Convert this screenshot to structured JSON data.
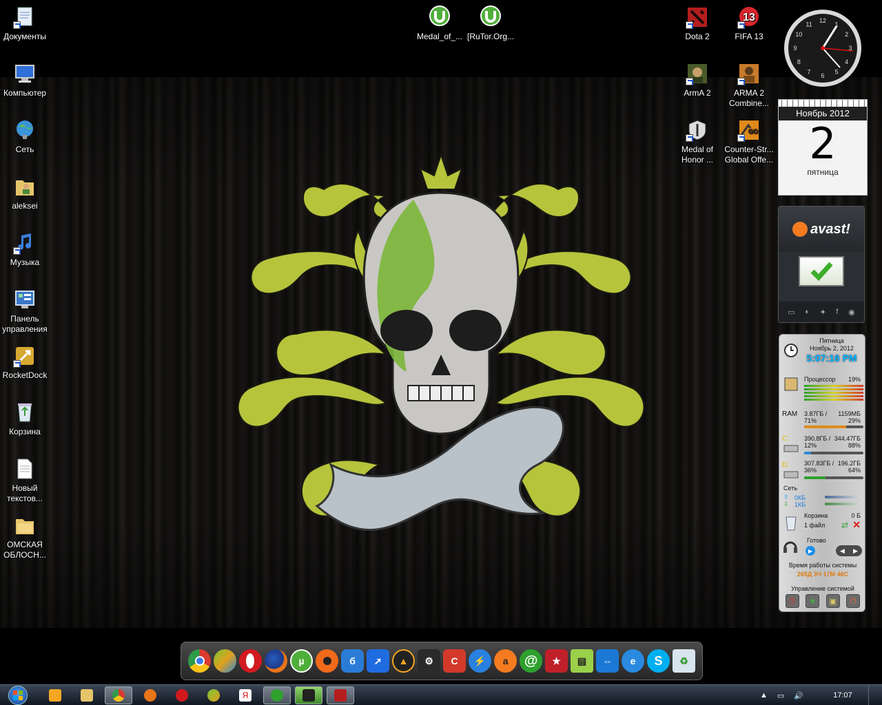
{
  "desktop_icons": {
    "documents": "Документы",
    "computer": "Компьютер",
    "network": "Сеть",
    "user": "aleksei",
    "music": "Музыка",
    "control_panel": "Панель управления",
    "rocketdock": "RocketDock",
    "recycle_bin": "Корзина",
    "new_text": "Новый текстов...",
    "folder": "ОМСКАЯ ОБЛОСН...",
    "torrent1": "Medal_of_...",
    "torrent2": "[RuTor.Org...",
    "dota2": "Dota 2",
    "fifa13": "FIFA 13",
    "fifa_badge": "13",
    "arma2": "ArmA 2",
    "arma2co": "ARMA 2 Combine...",
    "moh": "Medal of Honor ...",
    "csgo": "Counter-Str... Global Offe...",
    "csgo_badge": "GO"
  },
  "calendar": {
    "month": "Ноябрь 2012",
    "day": "2",
    "weekday": "пятница"
  },
  "avast": {
    "logo": "avast!"
  },
  "clock": {
    "numbers": [
      "12",
      "1",
      "2",
      "3",
      "4",
      "5",
      "6",
      "7",
      "8",
      "9",
      "10",
      "11"
    ]
  },
  "system_gadget": {
    "weekday": "Пятница",
    "date": "Ноябрь 2, 2012",
    "time": "5:07:16 PM",
    "cpu_label": "Процессор",
    "cpu_pct": "19%",
    "ram_label": "RAM",
    "ram_used": "3.87ГБ / 71%",
    "ram_free": "1159МБ 29%",
    "c_label": "C:",
    "c_used": "390.8ГБ / 12%",
    "c_free": "344.47ГБ 88%",
    "d_label": "D:",
    "d_used": "307.83ГБ / 36%",
    "d_free": "196.2ГБ 64%",
    "net_label": "Сеть",
    "net_up": "0КБ",
    "net_down": "1КБ",
    "bin_label": "Корзина",
    "bin_size": "0 Б",
    "bin_files": "1 файл",
    "media_status": "Готово",
    "uptime_label": "Время работы системы",
    "uptime": "265Д 3Ч 17М 46С",
    "control_label": "Управление системой"
  },
  "taskbar": {
    "time": "17:07"
  },
  "dock_items": [
    "chrome-icon",
    "mediaget-icon",
    "opera-icon",
    "firefox-icon",
    "utorrent-icon",
    "origin-icon",
    "uplay-icon",
    "rocket-icon",
    "aimp-icon",
    "steam-icon",
    "ccleaner-icon",
    "downloader-icon",
    "avast-icon",
    "mail-ru-agent-icon",
    "yandex-tool-icon",
    "battery-tool-icon",
    "teamviewer-icon",
    "ie-icon",
    "skype-icon",
    "recycle-bin-icon"
  ],
  "colors": {
    "accent_green": "#b6c43c",
    "clock_time": "#00bfff",
    "uptime": "#e07a10",
    "avast_orange": "#f47b20"
  }
}
